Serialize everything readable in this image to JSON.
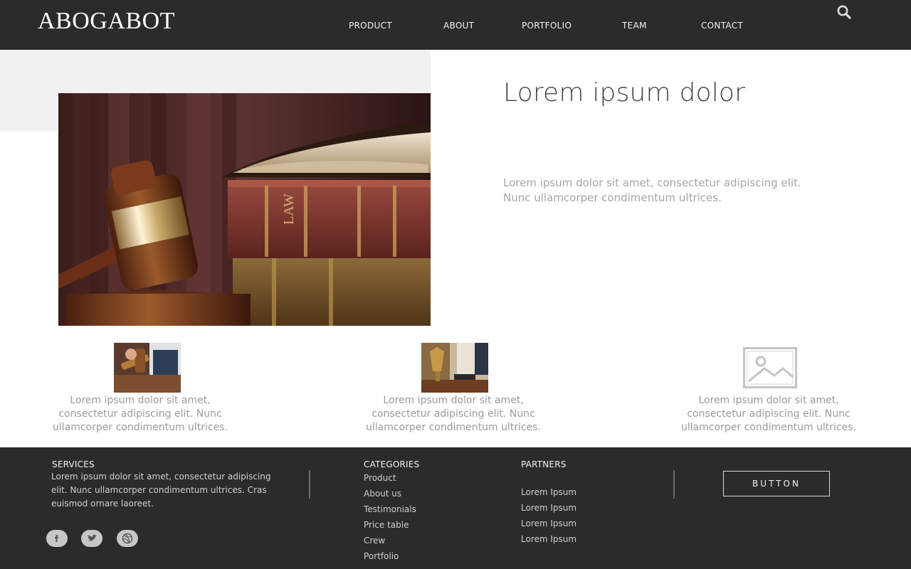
{
  "brand": {
    "logo": "ABOGABOT"
  },
  "nav": {
    "items": [
      {
        "label": "PRODUCT"
      },
      {
        "label": "ABOUT"
      },
      {
        "label": "PORTFOLIO"
      },
      {
        "label": "TEAM"
      },
      {
        "label": "CONTACT"
      }
    ],
    "search_icon": "search-icon"
  },
  "hero": {
    "title": "Lorem ipsum dolor",
    "text": "Lorem ipsum dolor sit amet, consectetur adipiscing elit. Nunc ullamcorper condimentum ultrices."
  },
  "features": [
    {
      "image": "gavel-photo",
      "text": "Lorem ipsum dolor sit amet, consectetur adipiscing elit. Nunc ullamcorper condimentum ultrices."
    },
    {
      "image": "justice-photo",
      "text": "Lorem ipsum dolor sit amet, consectetur adipiscing elit. Nunc ullamcorper condimentum ultrices."
    },
    {
      "image": "image-placeholder-icon",
      "text": "Lorem ipsum dolor sit amet, consectetur adipiscing elit. Nunc ullamcorper condimentum ultrices."
    }
  ],
  "footer": {
    "services": {
      "heading": "SERVICES",
      "text": "Lorem ipsum dolor sit amet, consectetur adipiscing elit. Nunc ullamcorper condimentum ultrices. Cras euismod ornare laoreet."
    },
    "categories": {
      "heading": "CATEGORIES",
      "links": [
        "Product",
        "About us",
        "Testimonials",
        "Price table",
        "Crew",
        "Portfolio"
      ]
    },
    "partners": {
      "heading": "PARTNERS",
      "links": [
        "Lorem Ipsum",
        "Lorem Ipsum",
        "Lorem Ipsum",
        "Lorem Ipsum"
      ]
    },
    "button_label": "BUTTON",
    "social_icons": [
      "facebook-icon",
      "twitter-icon",
      "dribbble-icon"
    ]
  },
  "colors": {
    "dark": "#2b2b2b",
    "light_panel": "#f1f1f1",
    "body_text": "#9a9a9a",
    "heading_text": "#444444"
  }
}
